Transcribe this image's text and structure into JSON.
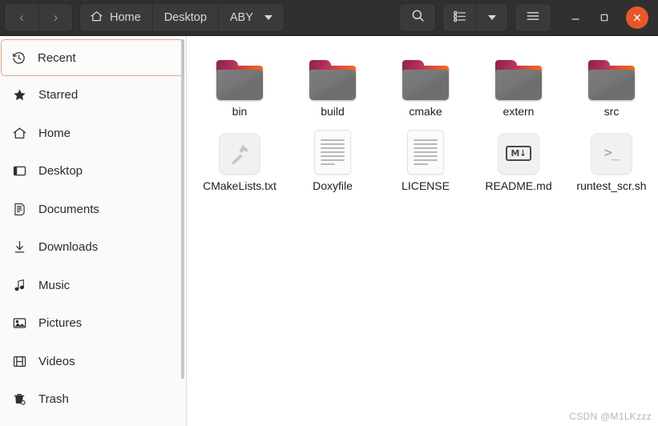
{
  "window": {
    "nav": {
      "back_label": "‹",
      "forward_label": "›"
    },
    "path_segments": [
      {
        "label": "Home",
        "icon": "home-icon",
        "has_caret": false
      },
      {
        "label": "Desktop",
        "icon": "",
        "has_caret": false
      },
      {
        "label": "ABY",
        "icon": "",
        "has_caret": true
      }
    ],
    "tools": {
      "search_label": "⌕",
      "view_list_label": "list-view-icon",
      "view_caret_label": "▾",
      "menu_label": "☰"
    },
    "controls": {
      "minimize_label": "–",
      "maximize_label": "□",
      "close_label": "✕"
    },
    "colors": {
      "headerbar_bg": "#303030",
      "button_bg": "#3a3a3a",
      "close_bg": "#e8572a",
      "selection_border": "#e8a288",
      "folder_gradient_start": "#8e2453",
      "folder_gradient_end": "#f26a22",
      "folder_body": "#757575"
    }
  },
  "sidebar": {
    "items": [
      {
        "label": "Recent",
        "icon": "clock-icon",
        "selected": true
      },
      {
        "label": "Starred",
        "icon": "star-icon",
        "selected": false
      },
      {
        "label": "Home",
        "icon": "home-icon",
        "selected": false
      },
      {
        "label": "Desktop",
        "icon": "desktop-icon",
        "selected": false
      },
      {
        "label": "Documents",
        "icon": "document-icon",
        "selected": false
      },
      {
        "label": "Downloads",
        "icon": "download-icon",
        "selected": false
      },
      {
        "label": "Music",
        "icon": "music-note-icon",
        "selected": false
      },
      {
        "label": "Pictures",
        "icon": "picture-icon",
        "selected": false
      },
      {
        "label": "Videos",
        "icon": "film-icon",
        "selected": false
      },
      {
        "label": "Trash",
        "icon": "trash-icon",
        "selected": false
      }
    ]
  },
  "files": {
    "items": [
      {
        "name": "bin",
        "type": "folder",
        "icon": "folder-icon"
      },
      {
        "name": "build",
        "type": "folder",
        "icon": "folder-icon"
      },
      {
        "name": "cmake",
        "type": "folder",
        "icon": "folder-icon"
      },
      {
        "name": "extern",
        "type": "folder",
        "icon": "folder-icon"
      },
      {
        "name": "src",
        "type": "folder",
        "icon": "folder-icon"
      },
      {
        "name": "CMakeLists.txt",
        "type": "file",
        "icon": "hammer-icon"
      },
      {
        "name": "Doxyfile",
        "type": "file",
        "icon": "text-document-icon"
      },
      {
        "name": "LICENSE",
        "type": "file",
        "icon": "text-document-icon"
      },
      {
        "name": "README.md",
        "type": "file",
        "icon": "markdown-icon",
        "badge": "M↓"
      },
      {
        "name": "runtest_scr.sh",
        "type": "file",
        "icon": "terminal-icon",
        "badge": ">_"
      }
    ]
  },
  "watermark": {
    "text": "CSDN @M1LKzzz"
  }
}
